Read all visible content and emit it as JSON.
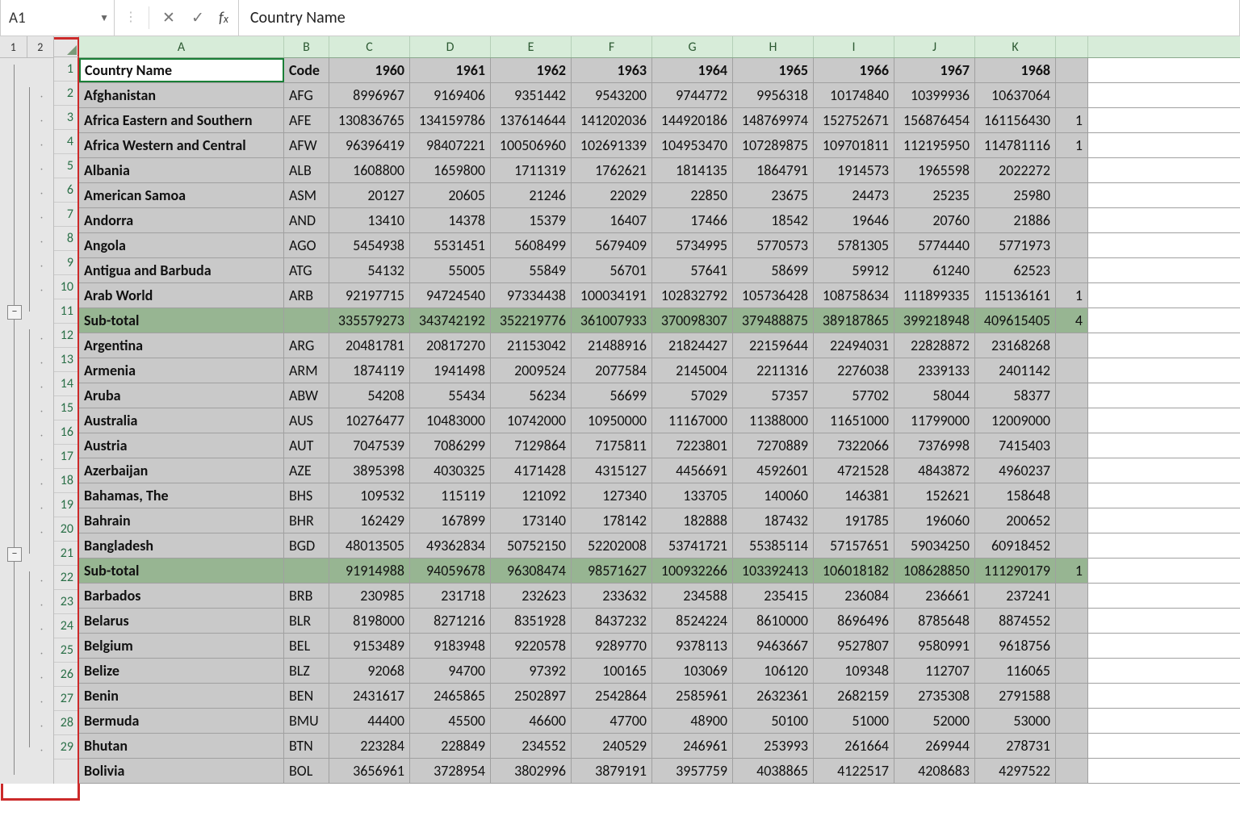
{
  "namebox": "A1",
  "formula_value": "Country Name",
  "outline_levels": [
    "1",
    "2"
  ],
  "column_letters": [
    "A",
    "B",
    "C",
    "D",
    "E",
    "F",
    "G",
    "H",
    "I",
    "J",
    "K",
    ""
  ],
  "header_row": [
    "Country Name",
    "Code",
    "1960",
    "1961",
    "1962",
    "1963",
    "1964",
    "1965",
    "1966",
    "1967",
    "1968",
    ""
  ],
  "rows": [
    {
      "n": 1,
      "type": "header",
      "cells": [
        "Country Name",
        "Code",
        "1960",
        "1961",
        "1962",
        "1963",
        "1964",
        "1965",
        "1966",
        "1967",
        "1968",
        ""
      ]
    },
    {
      "n": 2,
      "type": "data",
      "cells": [
        "Afghanistan",
        "AFG",
        "8996967",
        "9169406",
        "9351442",
        "9543200",
        "9744772",
        "9956318",
        "10174840",
        "10399936",
        "10637064",
        ""
      ]
    },
    {
      "n": 3,
      "type": "data",
      "cells": [
        "Africa Eastern and Southern",
        "AFE",
        "130836765",
        "134159786",
        "137614644",
        "141202036",
        "144920186",
        "148769974",
        "152752671",
        "156876454",
        "161156430",
        "1"
      ]
    },
    {
      "n": 4,
      "type": "data",
      "cells": [
        "Africa Western and Central",
        "AFW",
        "96396419",
        "98407221",
        "100506960",
        "102691339",
        "104953470",
        "107289875",
        "109701811",
        "112195950",
        "114781116",
        "1"
      ]
    },
    {
      "n": 5,
      "type": "data",
      "cells": [
        "Albania",
        "ALB",
        "1608800",
        "1659800",
        "1711319",
        "1762621",
        "1814135",
        "1864791",
        "1914573",
        "1965598",
        "2022272",
        ""
      ]
    },
    {
      "n": 6,
      "type": "data",
      "cells": [
        "American Samoa",
        "ASM",
        "20127",
        "20605",
        "21246",
        "22029",
        "22850",
        "23675",
        "24473",
        "25235",
        "25980",
        ""
      ]
    },
    {
      "n": 7,
      "type": "data",
      "cells": [
        "Andorra",
        "AND",
        "13410",
        "14378",
        "15379",
        "16407",
        "17466",
        "18542",
        "19646",
        "20760",
        "21886",
        ""
      ]
    },
    {
      "n": 8,
      "type": "data",
      "cells": [
        "Angola",
        "AGO",
        "5454938",
        "5531451",
        "5608499",
        "5679409",
        "5734995",
        "5770573",
        "5781305",
        "5774440",
        "5771973",
        ""
      ]
    },
    {
      "n": 9,
      "type": "data",
      "cells": [
        "Antigua and Barbuda",
        "ATG",
        "54132",
        "55005",
        "55849",
        "56701",
        "57641",
        "58699",
        "59912",
        "61240",
        "62523",
        ""
      ]
    },
    {
      "n": 10,
      "type": "data",
      "cells": [
        "Arab World",
        "ARB",
        "92197715",
        "94724540",
        "97334438",
        "100034191",
        "102832792",
        "105736428",
        "108758634",
        "111899335",
        "115136161",
        "1"
      ]
    },
    {
      "n": 11,
      "type": "subtotal",
      "cells": [
        "Sub-total",
        "",
        "335579273",
        "343742192",
        "352219776",
        "361007933",
        "370098307",
        "379488875",
        "389187865",
        "399218948",
        "409615405",
        "4"
      ]
    },
    {
      "n": 12,
      "type": "data",
      "cells": [
        "Argentina",
        "ARG",
        "20481781",
        "20817270",
        "21153042",
        "21488916",
        "21824427",
        "22159644",
        "22494031",
        "22828872",
        "23168268",
        ""
      ]
    },
    {
      "n": 13,
      "type": "data",
      "cells": [
        "Armenia",
        "ARM",
        "1874119",
        "1941498",
        "2009524",
        "2077584",
        "2145004",
        "2211316",
        "2276038",
        "2339133",
        "2401142",
        ""
      ]
    },
    {
      "n": 14,
      "type": "data",
      "cells": [
        "Aruba",
        "ABW",
        "54208",
        "55434",
        "56234",
        "56699",
        "57029",
        "57357",
        "57702",
        "58044",
        "58377",
        ""
      ]
    },
    {
      "n": 15,
      "type": "data",
      "cells": [
        "Australia",
        "AUS",
        "10276477",
        "10483000",
        "10742000",
        "10950000",
        "11167000",
        "11388000",
        "11651000",
        "11799000",
        "12009000",
        ""
      ]
    },
    {
      "n": 16,
      "type": "data",
      "cells": [
        "Austria",
        "AUT",
        "7047539",
        "7086299",
        "7129864",
        "7175811",
        "7223801",
        "7270889",
        "7322066",
        "7376998",
        "7415403",
        ""
      ]
    },
    {
      "n": 17,
      "type": "data",
      "cells": [
        "Azerbaijan",
        "AZE",
        "3895398",
        "4030325",
        "4171428",
        "4315127",
        "4456691",
        "4592601",
        "4721528",
        "4843872",
        "4960237",
        ""
      ]
    },
    {
      "n": 18,
      "type": "data",
      "cells": [
        "Bahamas, The",
        "BHS",
        "109532",
        "115119",
        "121092",
        "127340",
        "133705",
        "140060",
        "146381",
        "152621",
        "158648",
        ""
      ]
    },
    {
      "n": 19,
      "type": "data",
      "cells": [
        "Bahrain",
        "BHR",
        "162429",
        "167899",
        "173140",
        "178142",
        "182888",
        "187432",
        "191785",
        "196060",
        "200652",
        ""
      ]
    },
    {
      "n": 20,
      "type": "data",
      "cells": [
        "Bangladesh",
        "BGD",
        "48013505",
        "49362834",
        "50752150",
        "52202008",
        "53741721",
        "55385114",
        "57157651",
        "59034250",
        "60918452",
        ""
      ]
    },
    {
      "n": 21,
      "type": "subtotal",
      "cells": [
        "Sub-total",
        "",
        "91914988",
        "94059678",
        "96308474",
        "98571627",
        "100932266",
        "103392413",
        "106018182",
        "108628850",
        "111290179",
        "1"
      ]
    },
    {
      "n": 22,
      "type": "data",
      "cells": [
        "Barbados",
        "BRB",
        "230985",
        "231718",
        "232623",
        "233632",
        "234588",
        "235415",
        "236084",
        "236661",
        "237241",
        ""
      ]
    },
    {
      "n": 23,
      "type": "data",
      "cells": [
        "Belarus",
        "BLR",
        "8198000",
        "8271216",
        "8351928",
        "8437232",
        "8524224",
        "8610000",
        "8696496",
        "8785648",
        "8874552",
        ""
      ]
    },
    {
      "n": 24,
      "type": "data",
      "cells": [
        "Belgium",
        "BEL",
        "9153489",
        "9183948",
        "9220578",
        "9289770",
        "9378113",
        "9463667",
        "9527807",
        "9580991",
        "9618756",
        ""
      ]
    },
    {
      "n": 25,
      "type": "data",
      "cells": [
        "Belize",
        "BLZ",
        "92068",
        "94700",
        "97392",
        "100165",
        "103069",
        "106120",
        "109348",
        "112707",
        "116065",
        ""
      ]
    },
    {
      "n": 26,
      "type": "data",
      "cells": [
        "Benin",
        "BEN",
        "2431617",
        "2465865",
        "2502897",
        "2542864",
        "2585961",
        "2632361",
        "2682159",
        "2735308",
        "2791588",
        ""
      ]
    },
    {
      "n": 27,
      "type": "data",
      "cells": [
        "Bermuda",
        "BMU",
        "44400",
        "45500",
        "46600",
        "47700",
        "48900",
        "50100",
        "51000",
        "52000",
        "53000",
        ""
      ]
    },
    {
      "n": 28,
      "type": "data",
      "cells": [
        "Bhutan",
        "BTN",
        "223284",
        "228849",
        "234552",
        "240529",
        "246961",
        "253993",
        "261664",
        "269944",
        "278731",
        ""
      ]
    },
    {
      "n": 29,
      "type": "data",
      "cells": [
        "Bolivia",
        "BOL",
        "3656961",
        "3728954",
        "3802996",
        "3879191",
        "3957759",
        "4038865",
        "4122517",
        "4208683",
        "4297522",
        ""
      ]
    }
  ],
  "outline": {
    "dots_rows": [
      2,
      3,
      4,
      5,
      6,
      7,
      8,
      9,
      10,
      12,
      13,
      14,
      15,
      16,
      17,
      18,
      19,
      20,
      22,
      23,
      24,
      25,
      26,
      27,
      28,
      29
    ],
    "collapse_rows": [
      11,
      21
    ],
    "group1": {
      "from": 1,
      "to": 29
    },
    "group2a": {
      "from": 2,
      "to": 11
    },
    "group2b": {
      "from": 12,
      "to": 21
    },
    "group2c": {
      "from": 22,
      "to": 29
    }
  },
  "minus_glyph": "−"
}
